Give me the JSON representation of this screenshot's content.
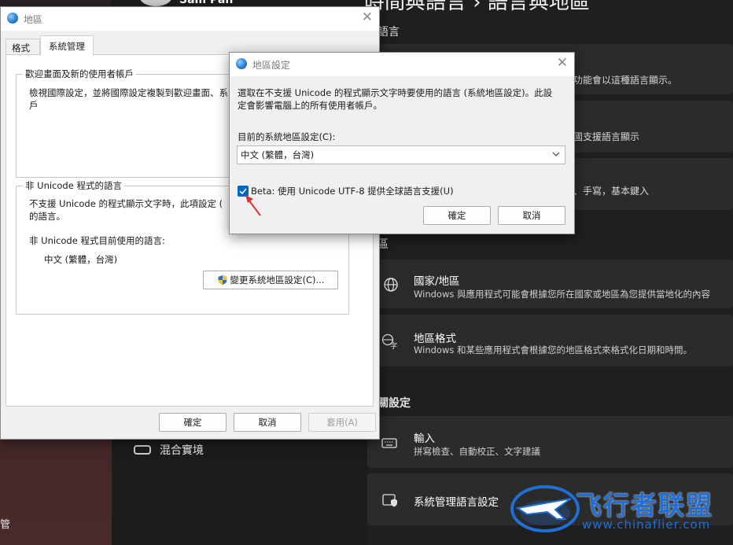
{
  "settings": {
    "header_title": "時間與語言 › 語言與地區",
    "header_user": "Sam Pan",
    "sub1": "語言",
    "card1_text": "功能會以這種語言顯示。",
    "card2_text": "國支援語言顯示",
    "card3_text": "、手寫，基本鍵入",
    "section_region": "區",
    "country_title": "國家/地區",
    "country_desc": "Windows 與應用程式可能會根據您所在國家或地區為您提供當地化的內容",
    "format_title": "地區格式",
    "format_desc": "Windows 和某些應用程式會根據您的地區格式來格式化日期和時間。",
    "section_related": "關設定",
    "input_title": "輸入",
    "input_desc": "拼寫檢查、自動校正、文字建議",
    "admin_lang": "系統管理語言設定",
    "left_item_mixed": "混合實境",
    "left_edge_char": "管"
  },
  "region_dialog": {
    "title": "地區",
    "tabs": [
      "格式",
      "系統管理"
    ],
    "welcome_group": "歡迎畫面及新的使用者帳戶",
    "welcome_text_line1": "檢視國際設定，並將國際設定複製到歡迎畫面、系",
    "welcome_text_line2": "戶",
    "nonunicode_group": "非 Unicode 程式的語言",
    "nonunicode_text_line1": "不支援 Unicode 的程式顯示文字時，此項設定 (",
    "nonunicode_text_line2": "的語言。",
    "current_label": "非 Unicode 程式目前使用的語言:",
    "current_value": "中文 (繁體，台灣)",
    "change_button": "變更系統地區設定(C)...",
    "ok": "確定",
    "cancel": "取消",
    "apply": "套用(A)"
  },
  "locale_dialog": {
    "title": "地區設定",
    "desc_line1": "選取在不支援 Unicode 的程式顯示文字時要使用的語言 (系統地區設定)。此設",
    "desc_line2": "定會影響電腦上的所有使用者帳戶。",
    "current_label": "目前的系統地區設定(C):",
    "locale_value": "中文 (繁體，台灣)",
    "beta_checked": true,
    "beta_label": "Beta: 使用 Unicode UTF-8 提供全球語言支援(U)",
    "ok": "確定",
    "cancel": "取消"
  },
  "watermark": {
    "name": "飞行者联盟",
    "url": "www.chinaflier.com"
  },
  "colors": {
    "accent": "#0067c0",
    "arrow": "#e0302f",
    "watermark": "#1f6fd6"
  }
}
